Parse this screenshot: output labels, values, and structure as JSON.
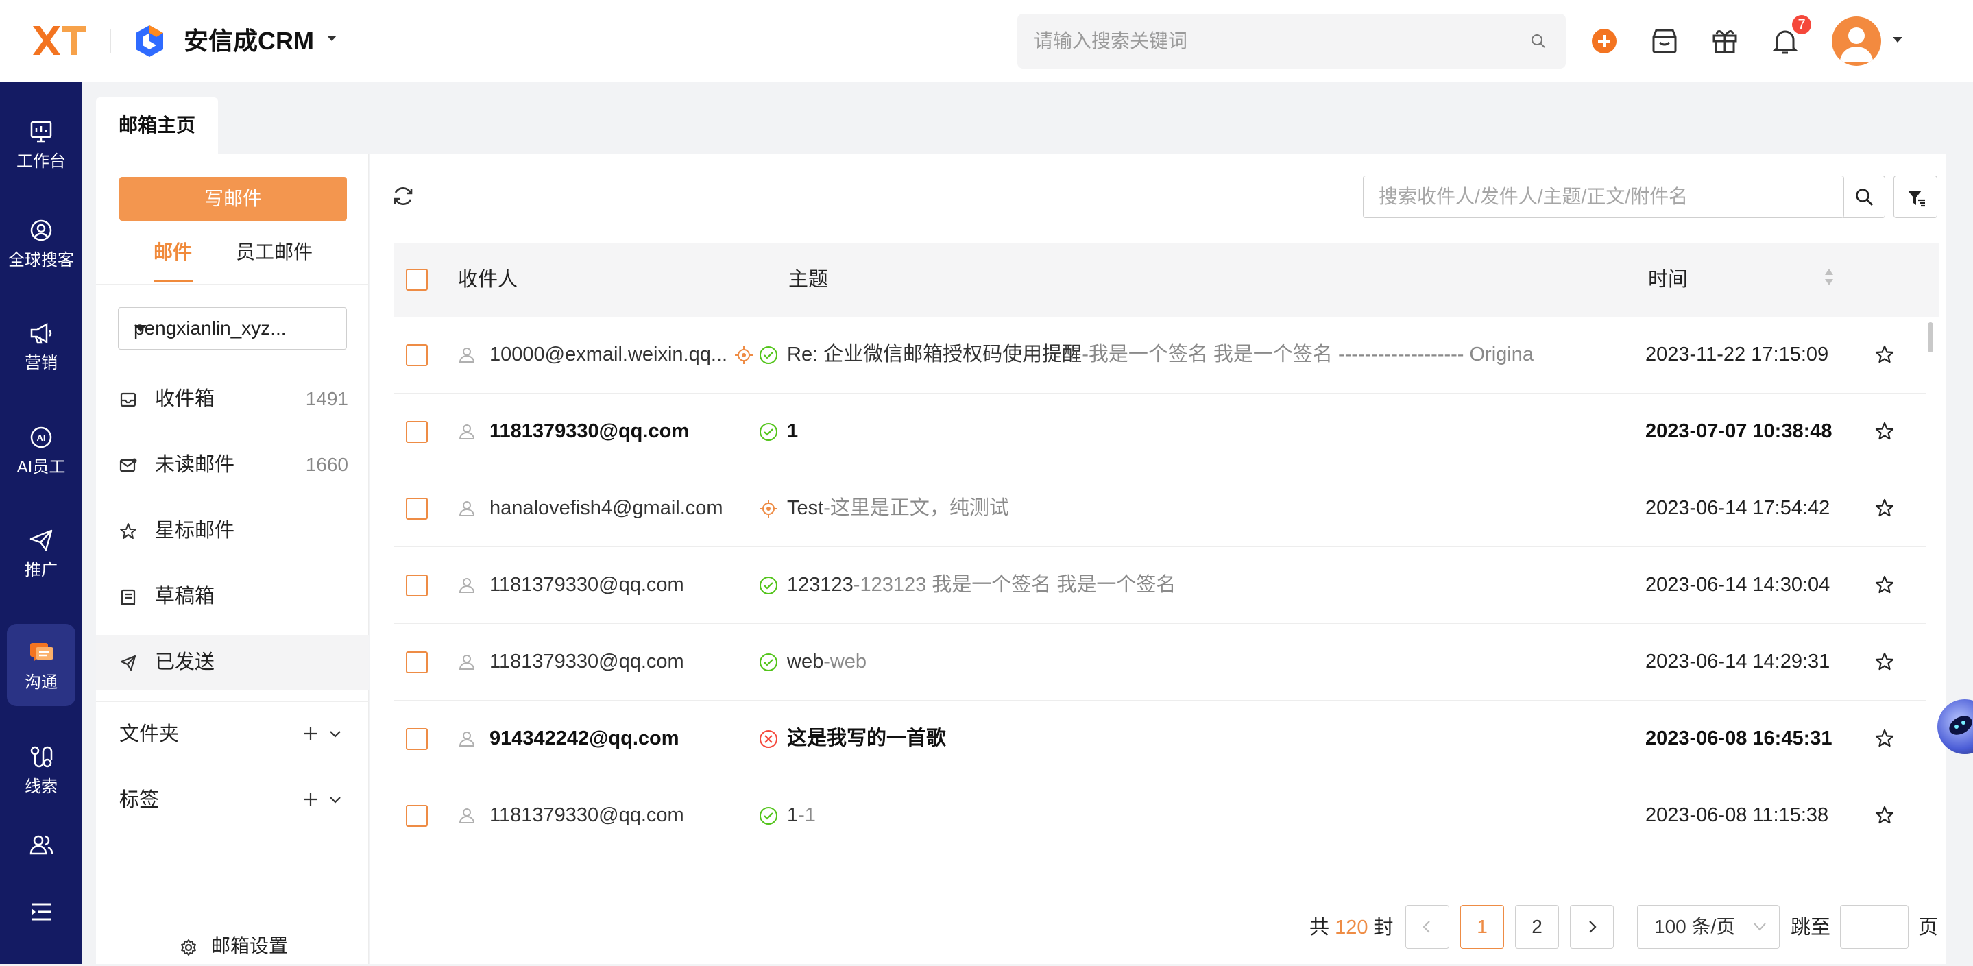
{
  "app": {
    "brand_logo_text": "XT",
    "brand_name": "安信成CRM"
  },
  "topbar": {
    "search_placeholder": "请输入搜索关键词",
    "notification_count": "7"
  },
  "nav": {
    "items": [
      {
        "label": "工作台",
        "icon": "monitor-icon"
      },
      {
        "label": "全球搜客",
        "icon": "search-user-icon"
      },
      {
        "label": "营销",
        "icon": "megaphone-icon"
      },
      {
        "label": "AI员工",
        "icon": "ai-icon"
      },
      {
        "label": "推广",
        "icon": "send-icon"
      },
      {
        "label": "沟通",
        "icon": "chat-icon",
        "active": true
      },
      {
        "label": "线索",
        "icon": "route-icon"
      },
      {
        "label": "",
        "icon": "team-icon"
      },
      {
        "label": "",
        "icon": "menu-collapse-icon"
      }
    ]
  },
  "tabs": [
    {
      "label": "邮箱主页",
      "active": true
    }
  ],
  "sidebar": {
    "compose_label": "写邮件",
    "subtabs": [
      {
        "label": "邮件",
        "active": true
      },
      {
        "label": "员工邮件",
        "active": false
      }
    ],
    "account": "pengxianlin_xyz...",
    "folders": [
      {
        "label": "收件箱",
        "count": "1491",
        "icon": "inbox-icon"
      },
      {
        "label": "未读邮件",
        "count": "1660",
        "icon": "unread-mail-icon"
      },
      {
        "label": "星标邮件",
        "count": "",
        "icon": "star-icon"
      },
      {
        "label": "草稿箱",
        "count": "",
        "icon": "draft-icon"
      },
      {
        "label": "已发送",
        "count": "",
        "icon": "sent-icon",
        "active": true
      }
    ],
    "groups": [
      {
        "label": "文件夹"
      },
      {
        "label": "标签"
      }
    ],
    "settings_label": "邮箱设置"
  },
  "mail": {
    "search_placeholder": "搜索收件人/发件人/主题/正文/附件名",
    "columns": {
      "recipient": "收件人",
      "subject": "主题",
      "time": "时间"
    },
    "rows": [
      {
        "recipient": "10000@exmail.weixin.qq...",
        "status": "success",
        "pinned": true,
        "subject": "Re: 企业微信邮箱授权码使用提醒",
        "preview": "-我是一个签名 我是一个签名 ------------------- Origina",
        "time": "2023-11-22 17:15:09",
        "unread": false
      },
      {
        "recipient": "1181379330@qq.com",
        "status": "success",
        "pinned": false,
        "subject": "1",
        "preview": "",
        "time": "2023-07-07 10:38:48",
        "unread": true
      },
      {
        "recipient": "hanalovefish4@gmail.com",
        "status": "none",
        "pinned": true,
        "subject": "Test",
        "preview": "-这里是正文，纯测试",
        "time": "2023-06-14 17:54:42",
        "unread": false
      },
      {
        "recipient": "1181379330@qq.com",
        "status": "success",
        "pinned": false,
        "subject": "123123",
        "preview": "-123123 我是一个签名 我是一个签名",
        "time": "2023-06-14 14:30:04",
        "unread": false
      },
      {
        "recipient": "1181379330@qq.com",
        "status": "success",
        "pinned": false,
        "subject": "web",
        "preview": "-web",
        "time": "2023-06-14 14:29:31",
        "unread": false
      },
      {
        "recipient": "914342242@qq.com",
        "status": "failed",
        "pinned": false,
        "subject": "这是我写的一首歌",
        "preview": "",
        "time": "2023-06-08 16:45:31",
        "unread": true
      },
      {
        "recipient": "1181379330@qq.com",
        "status": "success",
        "pinned": false,
        "subject": "1",
        "preview": "-1",
        "time": "2023-06-08 11:15:38",
        "unread": false
      }
    ]
  },
  "pagination": {
    "total_prefix": "共",
    "total": "120",
    "total_suffix": "封",
    "pages": [
      "1",
      "2"
    ],
    "current": "1",
    "page_size": "100 条/页",
    "jump_label": "跳至",
    "jump_suffix": "页"
  },
  "colors": {
    "accent": "#EE8C45",
    "nav_bg": "#141B63",
    "success": "#52C41A",
    "failed": "#F5483B"
  }
}
